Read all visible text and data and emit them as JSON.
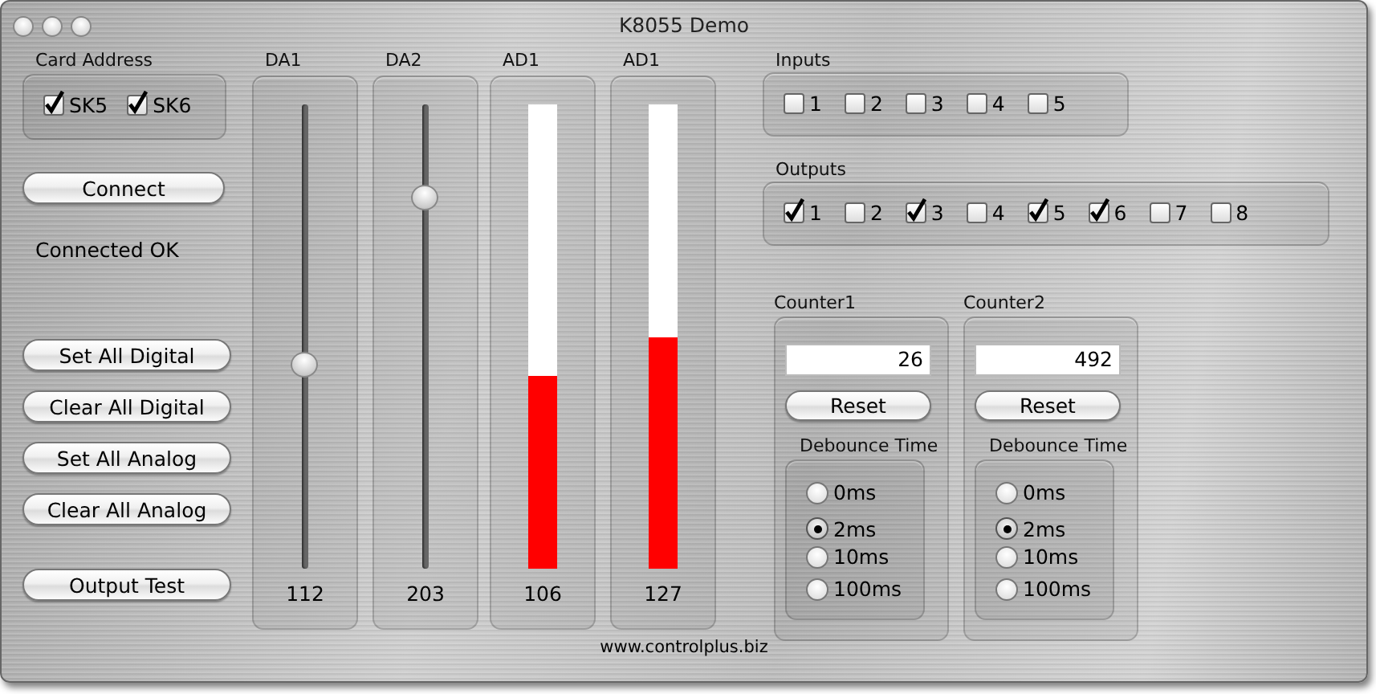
{
  "window": {
    "title": "K8055 Demo"
  },
  "card_address": {
    "label": "Card Address",
    "options": [
      {
        "label": "SK5",
        "checked": true
      },
      {
        "label": "SK6",
        "checked": true
      }
    ]
  },
  "connect_button": "Connect",
  "status": "Connected OK",
  "actions": [
    "Set All Digital",
    "Clear All Digital",
    "Set All Analog",
    "Clear All Analog"
  ],
  "test_button": "Output Test",
  "channels": [
    {
      "kind": "slider",
      "label": "DA1",
      "level": 0.44,
      "reading": "112"
    },
    {
      "kind": "slider",
      "label": "DA2",
      "level": 0.8,
      "reading": "203"
    },
    {
      "kind": "meter",
      "label": "AD1",
      "level": 0.416,
      "reading": "106"
    },
    {
      "kind": "meter",
      "label": "AD1",
      "level": 0.498,
      "reading": "127"
    }
  ],
  "inputs": {
    "label": "Inputs",
    "items": [
      {
        "label": "1",
        "checked": false
      },
      {
        "label": "2",
        "checked": false
      },
      {
        "label": "3",
        "checked": false
      },
      {
        "label": "4",
        "checked": false
      },
      {
        "label": "5",
        "checked": false
      }
    ]
  },
  "outputs": {
    "label": "Outputs",
    "items": [
      {
        "label": "1",
        "checked": true
      },
      {
        "label": "2",
        "checked": false
      },
      {
        "label": "3",
        "checked": true
      },
      {
        "label": "4",
        "checked": false
      },
      {
        "label": "5",
        "checked": true
      },
      {
        "label": "6",
        "checked": true
      },
      {
        "label": "7",
        "checked": false
      },
      {
        "label": "8",
        "checked": false
      }
    ]
  },
  "counters": [
    {
      "label": "Counter1",
      "value": "26",
      "reset": "Reset",
      "debounce": {
        "label": "Debounce Time",
        "options": [
          {
            "label": "0ms",
            "selected": false
          },
          {
            "label": "2ms",
            "selected": true
          },
          {
            "label": "10ms",
            "selected": false
          },
          {
            "label": "100ms",
            "selected": false
          }
        ]
      }
    },
    {
      "label": "Counter2",
      "value": "492",
      "reset": "Reset",
      "debounce": {
        "label": "Debounce Time",
        "options": [
          {
            "label": "0ms",
            "selected": false
          },
          {
            "label": "2ms",
            "selected": true
          },
          {
            "label": "10ms",
            "selected": false
          },
          {
            "label": "100ms",
            "selected": false
          }
        ]
      }
    }
  ],
  "footer": "www.controlplus.biz"
}
